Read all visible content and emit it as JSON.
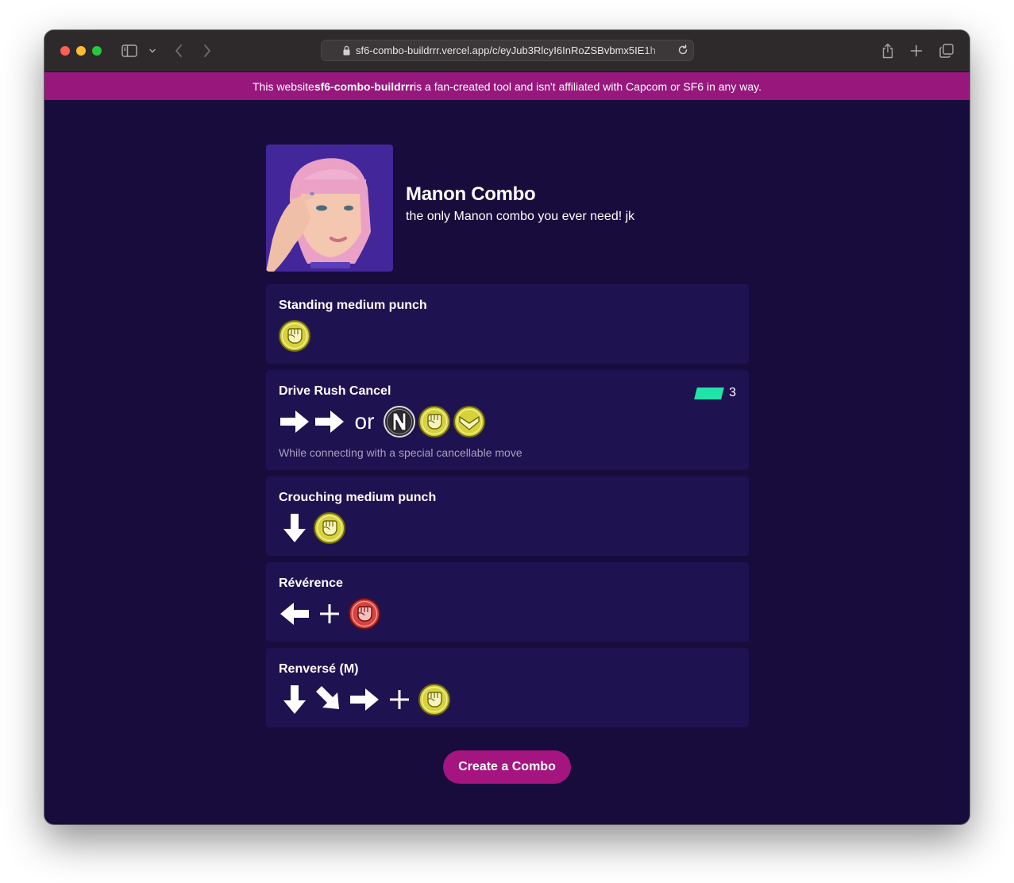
{
  "browser": {
    "url": "sf6-combo-buildrrr.vercel.app/c/eyJub3RlcyI6InRoZSBvbmx5IE1h"
  },
  "banner": {
    "prefix": "This website ",
    "site_name": "sf6-combo-buildrrr",
    "suffix": " is a fan-created tool and isn't affiliated with Capcom or SF6 in any way."
  },
  "combo": {
    "title": "Manon Combo",
    "description": "the only Manon combo you ever need! jk",
    "character_image": "manon-portrait"
  },
  "moves": [
    {
      "name": "Standing medium punch",
      "inputs": [
        "medium-punch"
      ]
    },
    {
      "name": "Drive Rush Cancel",
      "drive_cost": "3",
      "inputs": [
        "right-arrow",
        "right-arrow",
        "or",
        "neutral",
        "medium-punch",
        "medium-kick"
      ],
      "or_label": "or",
      "note": "While connecting with a special cancellable move"
    },
    {
      "name": "Crouching medium punch",
      "inputs": [
        "down-arrow",
        "medium-punch"
      ]
    },
    {
      "name": "Révérence",
      "inputs": [
        "left-arrow",
        "plus",
        "heavy-punch"
      ]
    },
    {
      "name": "Renversé (M)",
      "inputs": [
        "down-arrow",
        "down-right-arrow",
        "right-arrow",
        "plus",
        "medium-punch"
      ]
    }
  ],
  "colors": {
    "background": "#170c3b",
    "card": "#1f1251",
    "banner": "#97177d",
    "accent_button": "#a4157f",
    "drive_gauge": "#1fe3a7",
    "medium_button": "#d6d23a",
    "heavy_button": "#d9423f"
  },
  "cta": {
    "label": "Create a Combo"
  }
}
